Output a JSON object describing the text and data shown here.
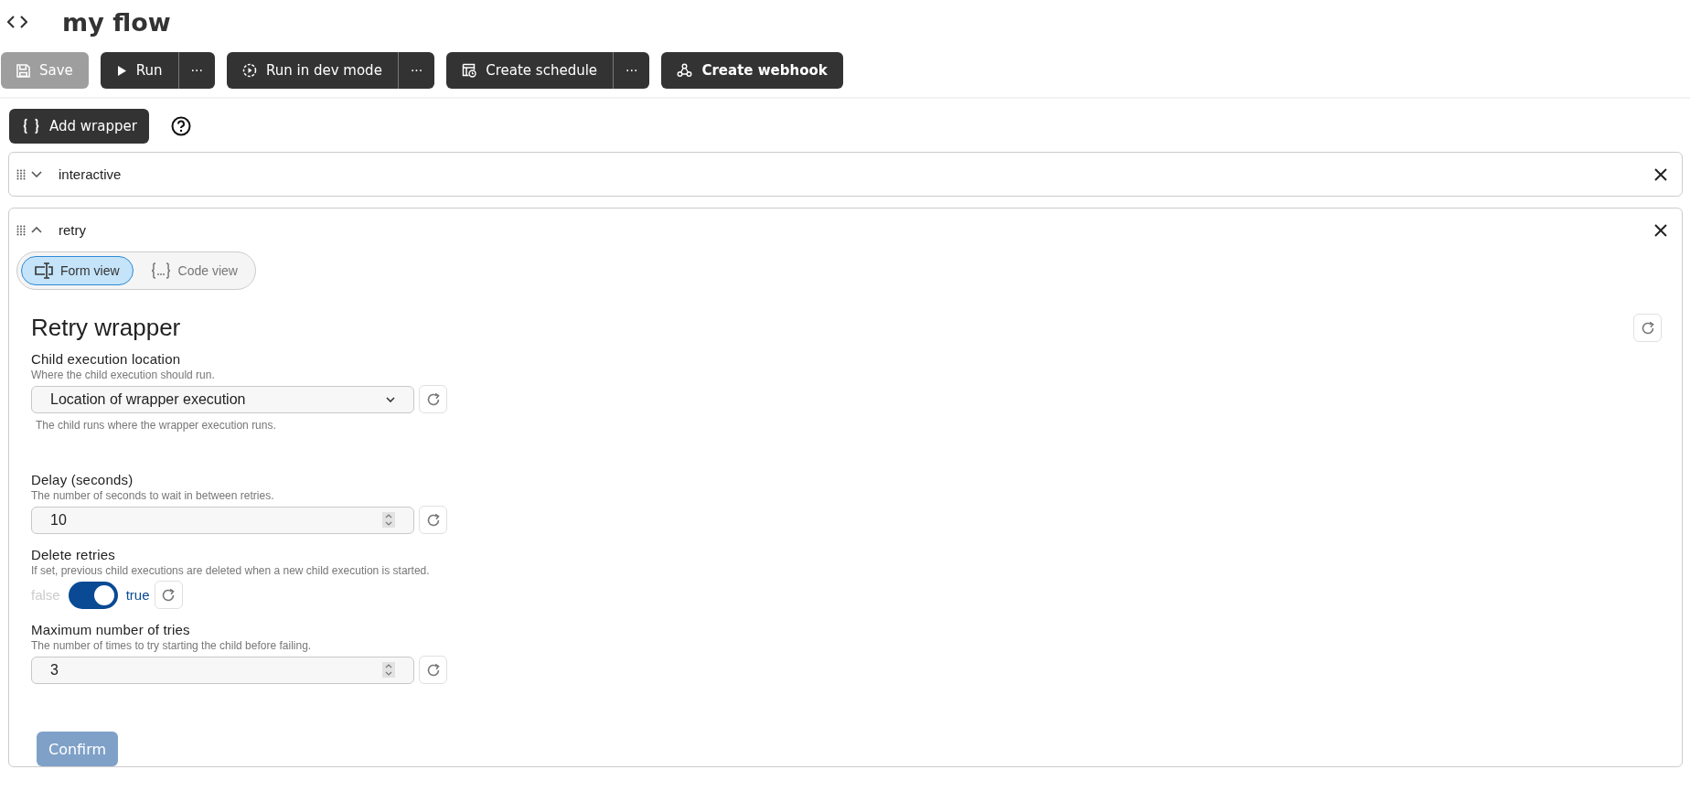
{
  "header": {
    "title": "my flow"
  },
  "toolbar": [
    {
      "kind": "save",
      "label": "Save",
      "disabled": true
    },
    {
      "kind": "run",
      "label": "Run",
      "disabled": false,
      "more": "···"
    },
    {
      "kind": "dev",
      "label": "Run in dev mode",
      "disabled": false,
      "more": "···"
    },
    {
      "kind": "schedule",
      "label": "Create schedule",
      "disabled": false,
      "more": "···"
    },
    {
      "kind": "webhook",
      "label": "Create webhook",
      "disabled": false
    }
  ],
  "add_wrapper": {
    "label": "Add wrapper"
  },
  "wrappers": [
    {
      "name": "interactive",
      "expanded": false
    },
    {
      "name": "retry",
      "expanded": true,
      "view_tabs": [
        {
          "kind": "form",
          "label": "Form view",
          "selected": true
        },
        {
          "kind": "code",
          "label": "Code view",
          "selected": false
        }
      ],
      "form": {
        "title": "Retry wrapper",
        "fields": [
          {
            "kind": "select",
            "label": "Child execution location",
            "description": "Where the child execution should run.",
            "value": "Location of wrapper execution",
            "hint": "The child runs where the wrapper execution runs."
          },
          {
            "kind": "number",
            "label": "Delay (seconds)",
            "description": "The number of seconds to wait in between retries.",
            "value": "10"
          },
          {
            "kind": "toggle",
            "label": "Delete retries",
            "description": "If set, previous child executions are deleted when a new child execution is started.",
            "off_label": "false",
            "on_label": "true",
            "on": true
          },
          {
            "kind": "number",
            "label": "Maximum number of tries",
            "description": "The number of times to try starting the child before failing.",
            "value": "3"
          }
        ]
      },
      "confirm": {
        "label": "Confirm",
        "disabled": true
      }
    }
  ]
}
